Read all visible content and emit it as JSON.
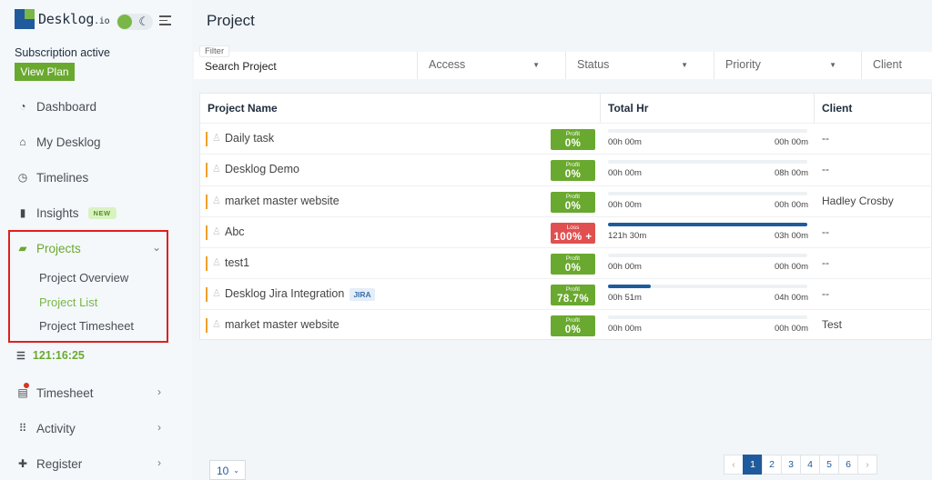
{
  "brand": {
    "name": "Desklog",
    "suffix": ".io"
  },
  "sidebar": {
    "subscription_status": "Subscription active",
    "view_plan_label": "View Plan",
    "items": [
      {
        "label": "Dashboard",
        "icon": "dashboard-icon"
      },
      {
        "label": "My Desklog",
        "icon": "home-icon"
      },
      {
        "label": "Timelines",
        "icon": "clock-icon"
      },
      {
        "label": "Insights",
        "icon": "book-icon",
        "badge": "NEW"
      },
      {
        "label": "Projects",
        "icon": "folder-icon",
        "active": true
      },
      {
        "label": "Timesheet",
        "icon": "timesheet-icon"
      },
      {
        "label": "Activity",
        "icon": "grid-icon"
      },
      {
        "label": "Register",
        "icon": "plus-icon"
      }
    ],
    "project_submenu": [
      "Project Overview",
      "Project List",
      "Project Timesheet"
    ],
    "timer": "121:16:25"
  },
  "page": {
    "title": "Project"
  },
  "filters": {
    "filter_label": "Filter",
    "search_label": "Search Project",
    "selects": [
      "Access",
      "Status",
      "Priority",
      "Client"
    ]
  },
  "table": {
    "headers": [
      "Project Name",
      "Total Hr",
      "Client"
    ],
    "rows": [
      {
        "name": "Daily task",
        "status_label": "Profit",
        "status_value": "0%",
        "type": "profit",
        "spent": "00h 00m",
        "total": "00h 00m",
        "progress": 0,
        "client": "--"
      },
      {
        "name": "Desklog Demo",
        "status_label": "Profit",
        "status_value": "0%",
        "type": "profit",
        "spent": "00h 00m",
        "total": "08h 00m",
        "progress": 0,
        "client": "--"
      },
      {
        "name": "market master website",
        "status_label": "Profit",
        "status_value": "0%",
        "type": "profit",
        "spent": "00h 00m",
        "total": "00h 00m",
        "progress": 0,
        "client": "Hadley Crosby"
      },
      {
        "name": "Abc",
        "status_label": "Loss",
        "status_value": "100% +",
        "type": "loss",
        "spent": "121h 30m",
        "total": "03h 00m",
        "progress": 1,
        "client": "--"
      },
      {
        "name": "test1",
        "status_label": "Profit",
        "status_value": "0%",
        "type": "profit",
        "spent": "00h 00m",
        "total": "00h 00m",
        "progress": 0,
        "client": "--"
      },
      {
        "name": "Desklog Jira Integration",
        "tag": "JIRA",
        "status_label": "Profit",
        "status_value": "78.7%",
        "type": "profit",
        "spent": "00h 51m",
        "total": "04h 00m",
        "progress": 0.213,
        "client": "--"
      },
      {
        "name": "market master website",
        "status_label": "Profit",
        "status_value": "0%",
        "type": "profit",
        "spent": "00h 00m",
        "total": "00h 00m",
        "progress": 0,
        "client": "Test"
      }
    ]
  },
  "footer": {
    "page_size": "10",
    "prev": "‹",
    "next": "›",
    "pages": [
      "1",
      "2",
      "3",
      "4",
      "5",
      "6"
    ],
    "current_page": "1"
  },
  "colors": {
    "accent_green": "#6aa92f",
    "loss_red": "#e05050",
    "bar_blue": "#1f5b9c",
    "highlight_red": "#e02020"
  }
}
